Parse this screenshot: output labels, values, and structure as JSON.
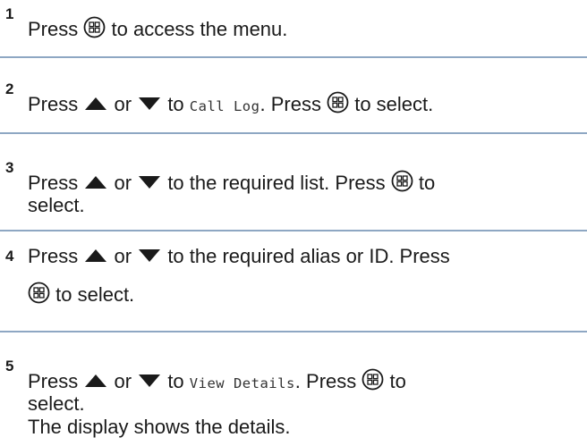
{
  "steps": [
    {
      "number": "1",
      "line1": {
        "press": "Press",
        "after_menu": "to access the menu."
      }
    },
    {
      "number": "2",
      "line1": {
        "press": "Press",
        "or": "or",
        "to": "to",
        "menu_item": "Call Log",
        "period": ".",
        "press2": "Press",
        "after_menu": "to select."
      }
    },
    {
      "number": "3",
      "line1": {
        "press": "Press",
        "or": "or",
        "text": "to the required list. Press",
        "after_menu": "to"
      },
      "line2": "select."
    },
    {
      "number": "4",
      "line1": {
        "press": "Press",
        "or": "or",
        "text": "to the required alias or ID. Press"
      },
      "line2": {
        "after_menu": "to select."
      }
    },
    {
      "number": "5",
      "line1": {
        "press": "Press",
        "or": "or",
        "to": "to",
        "menu_item": "View Details",
        "period": ".",
        "press2": "Press",
        "after_menu": "to"
      },
      "line2": "select.",
      "line3": "The display shows the details."
    }
  ],
  "icons": {
    "menu_ok": "menu-ok-button-icon",
    "up": "up-arrow-icon",
    "down": "down-arrow-icon"
  },
  "colors": {
    "divider": "#8ea7c3",
    "text": "#1a1a1a"
  }
}
